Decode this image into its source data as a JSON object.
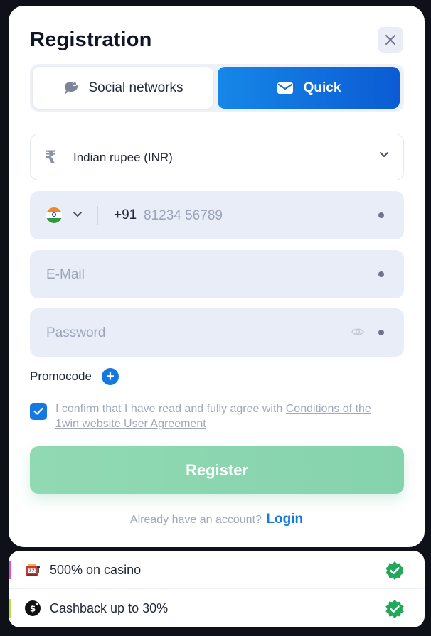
{
  "modal": {
    "title": "Registration",
    "tabs": [
      {
        "label": "Social networks",
        "icon": "chat-bubble-icon"
      },
      {
        "label": "Quick",
        "icon": "envelope-icon"
      }
    ],
    "active_tab": "Quick",
    "currency": {
      "symbol": "₹",
      "label": "Indian rupee (INR)"
    },
    "phone": {
      "country_code": "+91",
      "placeholder": "81234 56789",
      "flag": "india-flag-icon"
    },
    "email": {
      "placeholder": "E-Mail"
    },
    "password": {
      "placeholder": "Password"
    },
    "promocode": {
      "label": "Promocode",
      "plus": "+"
    },
    "agreement": {
      "checked": true,
      "text": "I confirm that I have read and fully agree with ",
      "link": "Conditions of the 1win website User Agreement"
    },
    "register_label": "Register",
    "login_prompt": "Already have an account?",
    "login_link": "Login"
  },
  "bonuses": [
    {
      "label": "500% on casino",
      "icon": "slot-machine-icon",
      "accent": "#d850d6"
    },
    {
      "label": "Cashback up to 30%",
      "icon": "cashback-icon",
      "accent": "#b7e03a"
    }
  ],
  "colors": {
    "accent_blue": "#1578e0",
    "register_green": "#8dd6b0",
    "field_bg": "#e9edf7",
    "check_green": "#22a85a"
  }
}
